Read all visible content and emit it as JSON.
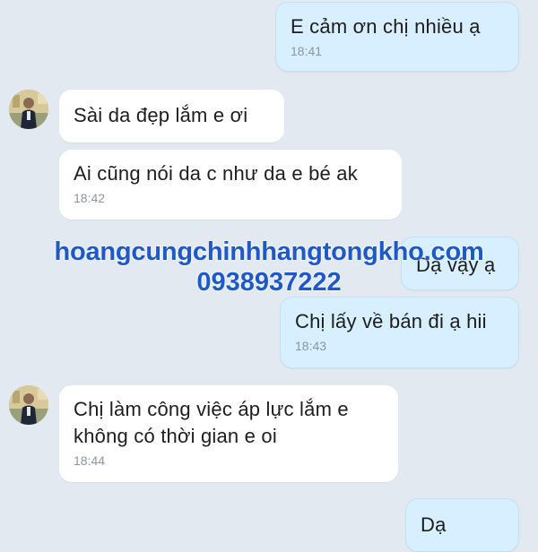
{
  "messages": [
    {
      "direction": "out",
      "text": "E cảm ơn chị nhiều ạ",
      "time": "18:41"
    },
    {
      "direction": "in",
      "text": "Sài da đẹp lắm e ơi",
      "time": ""
    },
    {
      "direction": "in",
      "text": "Ai cũng nói da c như da e bé ak",
      "time": "18:42"
    },
    {
      "direction": "out",
      "text": "Dạ vậy ạ",
      "time": ""
    },
    {
      "direction": "out",
      "text": "Chị lấy về bán đi ạ hii",
      "time": "18:43"
    },
    {
      "direction": "in",
      "text": "Chị làm công việc áp lực lắm e\nkhông có thời gian e oi",
      "time": "18:44"
    },
    {
      "direction": "out",
      "text": "Dạ",
      "time": ""
    }
  ],
  "watermark": {
    "site": "hoangcungchinhhangtongkho.com",
    "phone": "0938937222"
  },
  "colors": {
    "background": "#e2e9f1",
    "incoming_bubble": "#ffffff",
    "outgoing_bubble": "#d7efff",
    "timestamp": "#8a96a3",
    "watermark": "#1e58c9"
  }
}
